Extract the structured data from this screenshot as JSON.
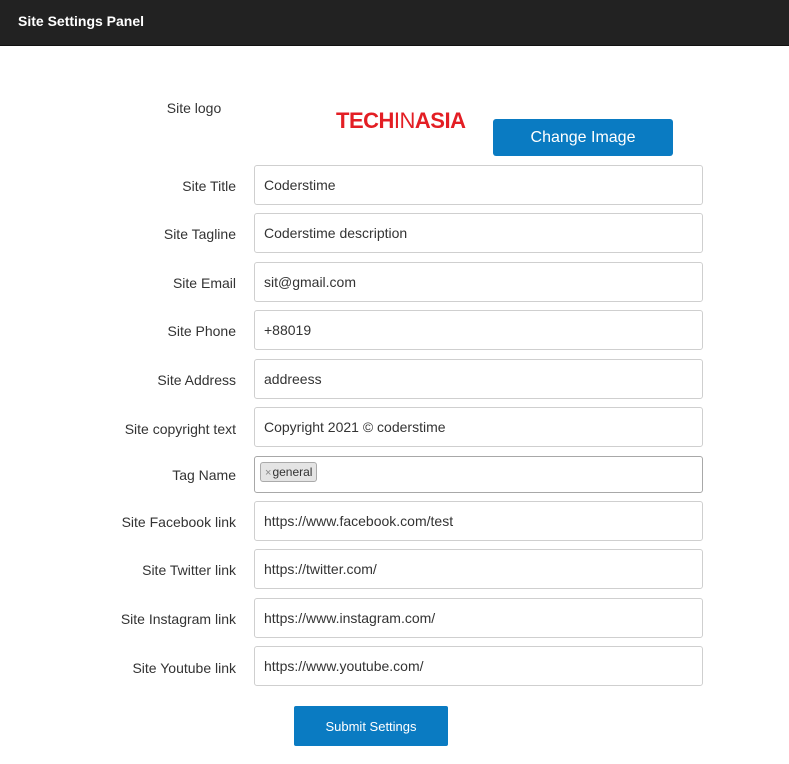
{
  "header": {
    "title": "Site Settings Panel"
  },
  "logo_section": {
    "label": "Site logo",
    "logo_text_bold_1": "TECH",
    "logo_text_thin": "IN",
    "logo_text_bold_2": "ASIA",
    "change_button": "Change Image"
  },
  "form": {
    "site_title": {
      "label": "Site Title",
      "value": "Coderstime"
    },
    "site_tagline": {
      "label": "Site Tagline",
      "value": "Coderstime description"
    },
    "site_email": {
      "label": "Site Email",
      "value": "sit@gmail.com"
    },
    "site_phone": {
      "label": "Site Phone",
      "value": "+88019"
    },
    "site_address": {
      "label": "Site Address",
      "value": "addreess"
    },
    "site_copyright": {
      "label": "Site copyright text",
      "value": "Copyright 2021 © coderstime"
    },
    "tag_name": {
      "label": "Tag Name",
      "remove_symbol": "×",
      "tags": [
        "general"
      ]
    },
    "site_facebook": {
      "label": "Site Facebook link",
      "value": "https://www.facebook.com/test"
    },
    "site_twitter": {
      "label": "Site Twitter link",
      "value": "https://twitter.com/"
    },
    "site_instagram": {
      "label": "Site Instagram link",
      "value": "https://www.instagram.com/"
    },
    "site_youtube": {
      "label": "Site Youtube link",
      "value": "https://www.youtube.com/"
    }
  },
  "submit_button": "Submit Settings",
  "colors": {
    "accent": "#0a7bc2",
    "header_bg": "#222222",
    "logo_red": "#e31e24"
  }
}
